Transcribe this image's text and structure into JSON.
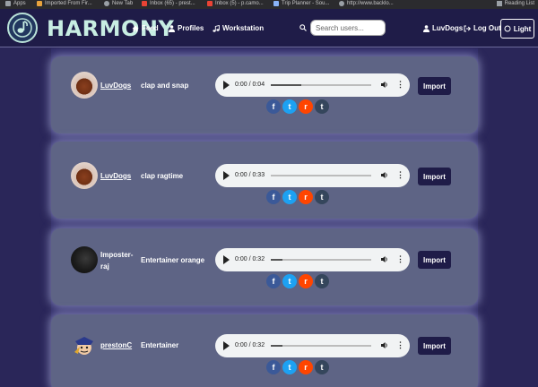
{
  "bookmarks": {
    "items": [
      {
        "label": "Apps",
        "color": "#9aa0a6"
      },
      {
        "label": "Imported From Fir...",
        "color": "#e8a33d"
      },
      {
        "label": "New Tab",
        "color": "#9aa0a6"
      },
      {
        "label": "Inbox (65) - prest...",
        "color": "#ea4335"
      },
      {
        "label": "Inbox (5) - p.camo...",
        "color": "#ea4335"
      },
      {
        "label": "Trip Planner - Sou...",
        "color": "#8ab4f8"
      },
      {
        "label": "http://www.backlo...",
        "color": "#9aa0a6"
      }
    ],
    "reading_list": "Reading List"
  },
  "nav": {
    "brand": "HARMONY",
    "feed": "Feed",
    "profiles": "Profiles",
    "workstation": "Workstation",
    "search_placeholder": "Search users...",
    "user": "LuvDogs",
    "logout": "Log Out",
    "theme": "Light"
  },
  "posts": [
    {
      "user": "LuvDogs",
      "title": "clap and snap",
      "time": "0:00 / 0:04",
      "progress": 0.3,
      "import": "Import",
      "avatar": "dog"
    },
    {
      "user": "LuvDogs",
      "title": "clap ragtime",
      "time": "0:00 / 0:33",
      "progress": 0.0,
      "import": "Import",
      "avatar": "dog"
    },
    {
      "user": "Imposter-raj",
      "title": "Entertainer orange",
      "time": "0:00 / 0:32",
      "progress": 0.12,
      "import": "Import",
      "avatar": "dark"
    },
    {
      "user": "prestonC",
      "title": "Entertainer",
      "time": "0:00 / 0:32",
      "progress": 0.12,
      "import": "Import",
      "avatar": "cartoon"
    }
  ],
  "share_buttons": [
    {
      "name": "facebook",
      "glyph": "f"
    },
    {
      "name": "twitter",
      "glyph": "t"
    },
    {
      "name": "reddit",
      "glyph": "r"
    },
    {
      "name": "tumblr",
      "glyph": "t"
    }
  ],
  "colors": {
    "background": "#2a2659",
    "navbar": "#1f1c48",
    "card": "#5e6485",
    "brand": "#c8eee3"
  }
}
